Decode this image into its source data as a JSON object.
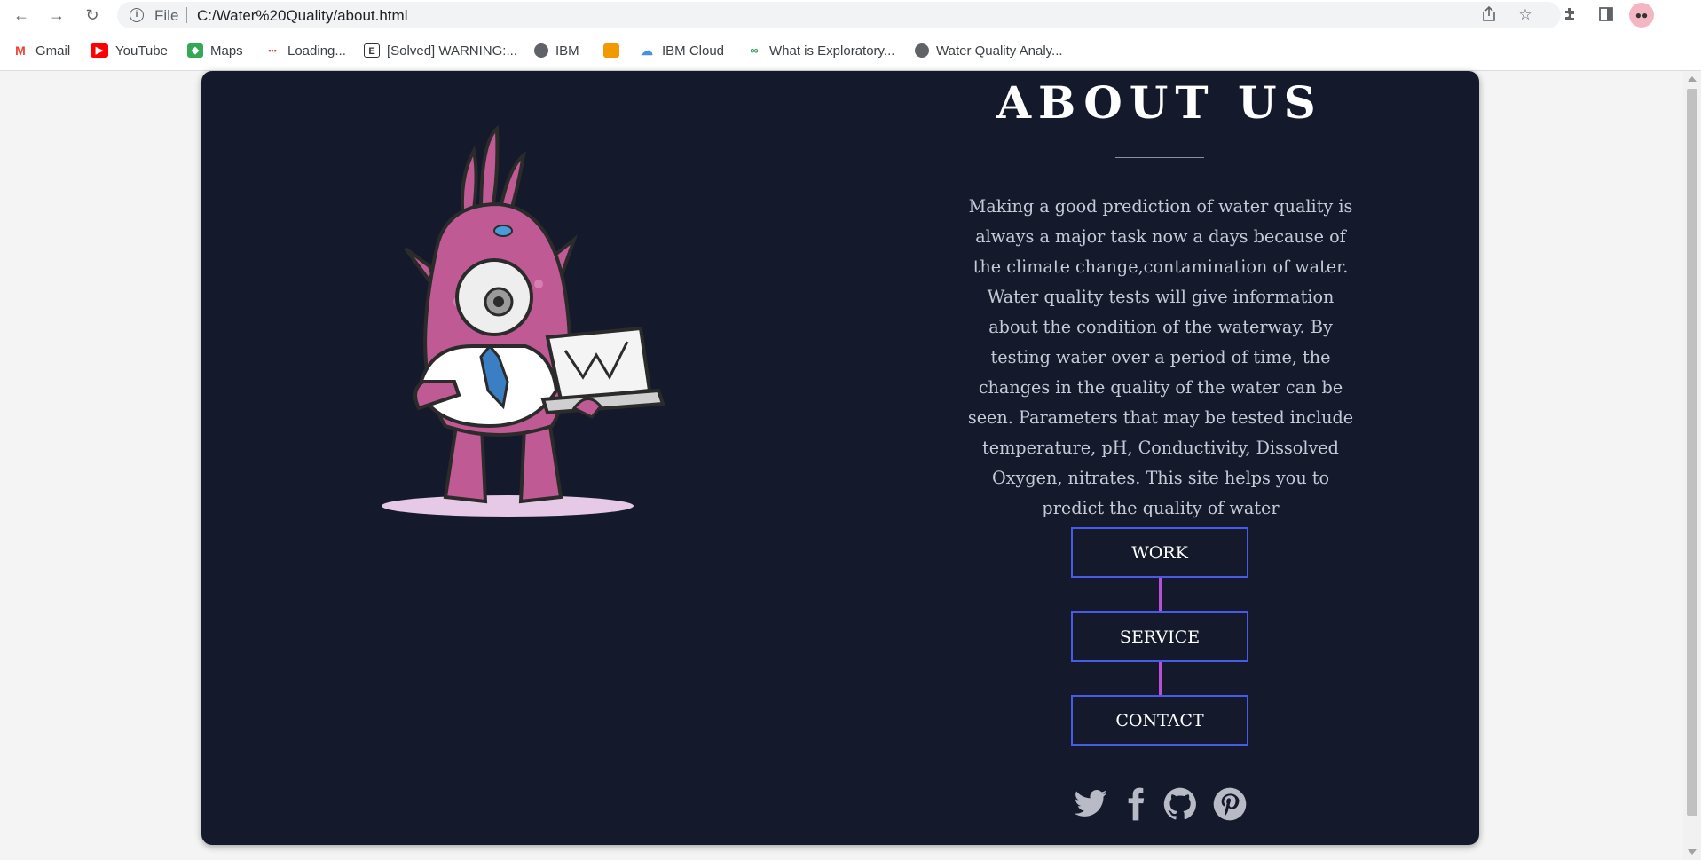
{
  "browser": {
    "file_label": "File",
    "url": "C:/Water%20Quality/about.html",
    "bookmarks": [
      {
        "label": "Gmail",
        "icon": "gmail-icon"
      },
      {
        "label": "YouTube",
        "icon": "youtube-icon"
      },
      {
        "label": "Maps",
        "icon": "maps-icon"
      },
      {
        "label": "Loading...",
        "icon": "loading-icon"
      },
      {
        "label": "[Solved] WARNING:...",
        "icon": "e-icon"
      },
      {
        "label": "IBM",
        "icon": "globe-icon"
      },
      {
        "label": "",
        "icon": "book-icon"
      },
      {
        "label": "IBM Cloud",
        "icon": "cloud-icon"
      },
      {
        "label": "What is Exploratory...",
        "icon": "link-icon"
      },
      {
        "label": "Water Quality Analy...",
        "icon": "globe-icon"
      }
    ]
  },
  "about": {
    "title": "ABOUT US",
    "description": "Making a good prediction of water quality is always a major task now a days because of the climate change,contamination of water. Water quality tests will give information about the condition of the waterway. By testing water over a period of time, the changes in the quality of the water can be seen. Parameters that may be tested include temperature, pH, Conductivity, Dissolved Oxygen, nitrates. This site helps you to predict the quality of water",
    "buttons": [
      "WORK",
      "SERVICE",
      "CONTACT"
    ],
    "social_icons": [
      "twitter-icon",
      "facebook-icon",
      "github-icon",
      "pinterest-icon"
    ]
  },
  "colors": {
    "card_bg": "#141a2b",
    "button_border": "#4a5ae8",
    "connector": "#b84fd8",
    "monster": "#c05a95"
  }
}
